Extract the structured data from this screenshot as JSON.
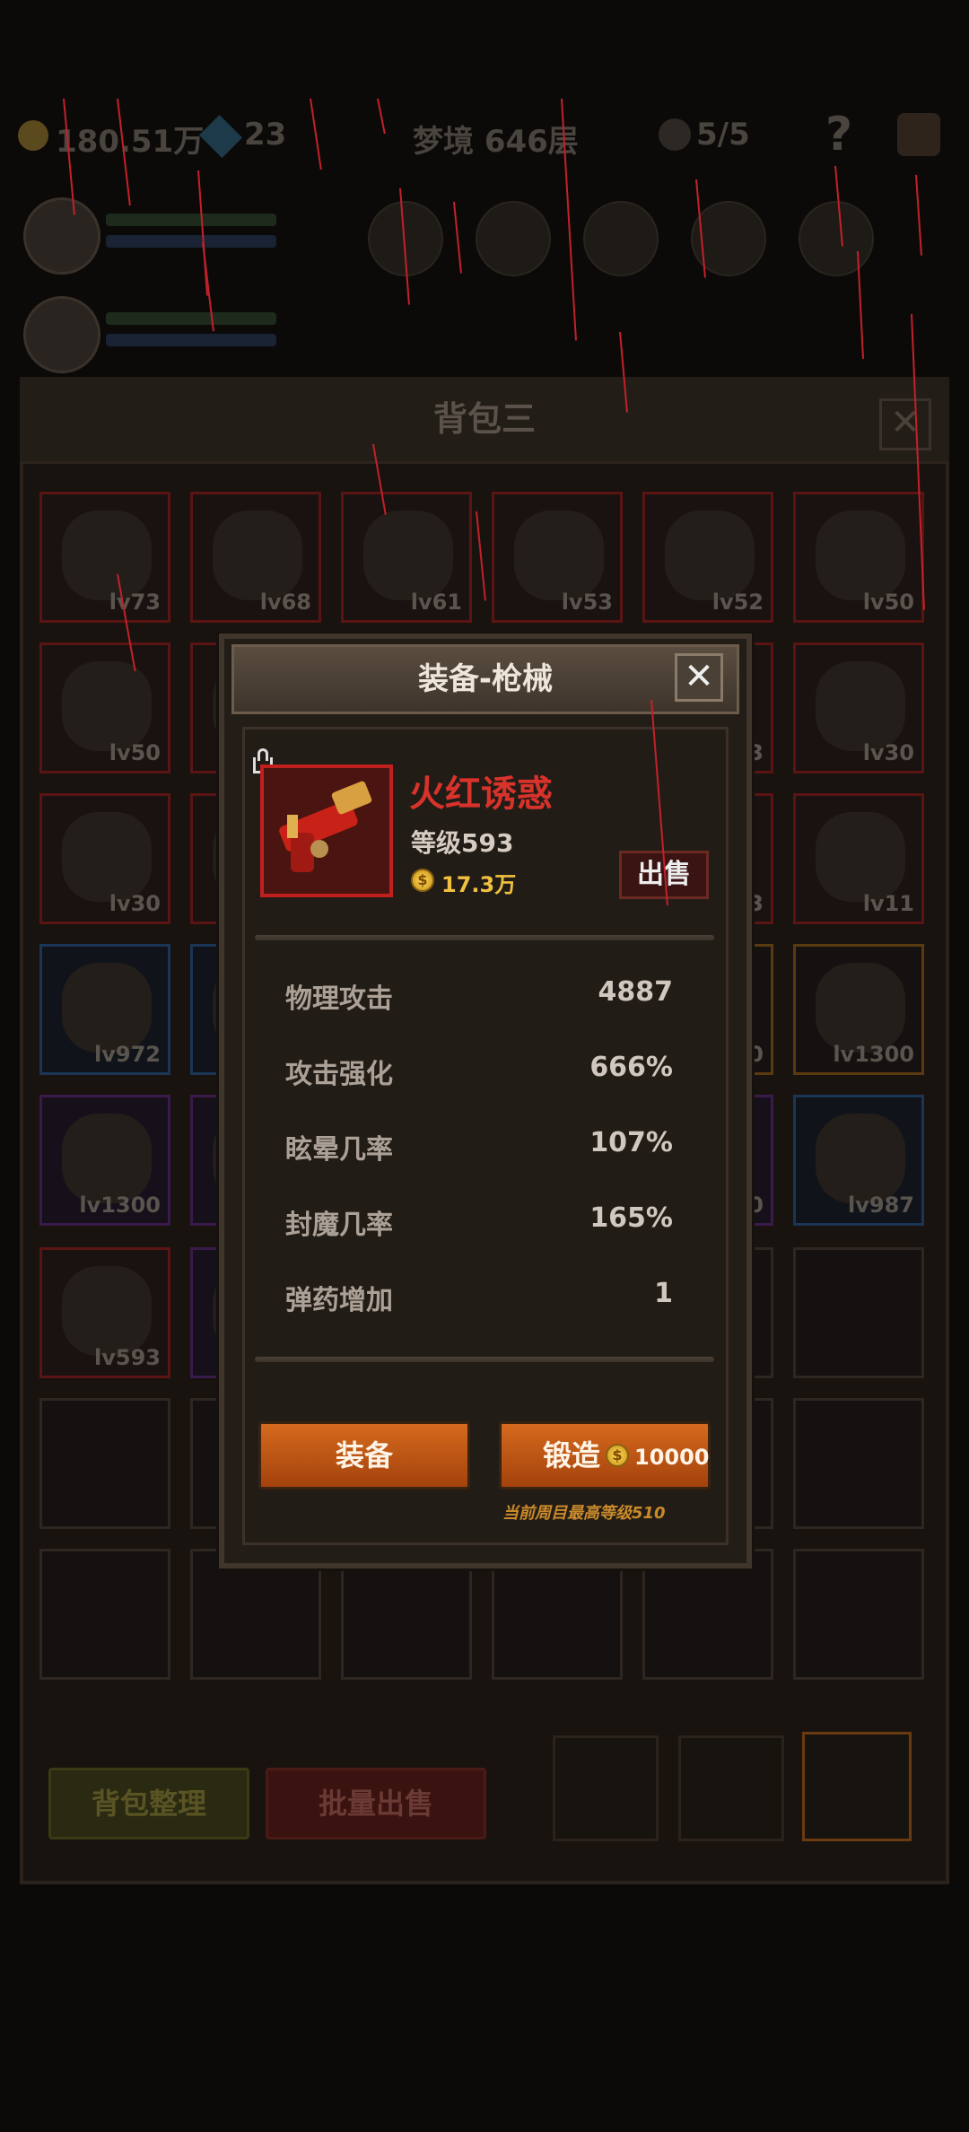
{
  "hud": {
    "gold": "180.51万",
    "gems": "23",
    "stage": "梦境 646层",
    "skulls": "5/5",
    "help": "?"
  },
  "bag": {
    "title": "背包三",
    "close": "✕",
    "slots": [
      {
        "lv": "lv73",
        "color": "red"
      },
      {
        "lv": "lv68",
        "color": "red"
      },
      {
        "lv": "lv61",
        "color": "red"
      },
      {
        "lv": "lv53",
        "color": "red"
      },
      {
        "lv": "lv52",
        "color": "red"
      },
      {
        "lv": "lv50",
        "color": "red"
      },
      {
        "lv": "lv50",
        "color": "red"
      },
      {
        "lv": "",
        "color": "red"
      },
      {
        "lv": "",
        "color": "red"
      },
      {
        "lv": "",
        "color": "red"
      },
      {
        "lv": "3",
        "color": "red"
      },
      {
        "lv": "lv30",
        "color": "red"
      },
      {
        "lv": "lv30",
        "color": "red"
      },
      {
        "lv": "",
        "color": "red"
      },
      {
        "lv": "",
        "color": "red"
      },
      {
        "lv": "",
        "color": "red"
      },
      {
        "lv": "3",
        "color": "red"
      },
      {
        "lv": "lv11",
        "color": "red"
      },
      {
        "lv": "lv972",
        "color": "blue"
      },
      {
        "lv": "",
        "color": "blue"
      },
      {
        "lv": "",
        "color": "blue"
      },
      {
        "lv": "",
        "color": "blue"
      },
      {
        "lv": "0",
        "color": "orange"
      },
      {
        "lv": "lv1300",
        "color": "orange"
      },
      {
        "lv": "lv1300",
        "color": "purple"
      },
      {
        "lv": "",
        "color": "purple"
      },
      {
        "lv": "",
        "color": "purple"
      },
      {
        "lv": "",
        "color": "purple"
      },
      {
        "lv": "00",
        "color": "purple"
      },
      {
        "lv": "lv987",
        "color": "blue"
      },
      {
        "lv": "lv593",
        "color": "red"
      },
      {
        "lv": "",
        "color": "purple"
      },
      {
        "lv": "",
        "color": "none"
      },
      {
        "lv": "",
        "color": "none"
      },
      {
        "lv": "",
        "color": "none"
      },
      {
        "lv": "",
        "color": "none"
      },
      {
        "lv": "",
        "color": "none"
      },
      {
        "lv": "",
        "color": "none"
      },
      {
        "lv": "",
        "color": "none"
      },
      {
        "lv": "",
        "color": "none"
      },
      {
        "lv": "",
        "color": "none"
      },
      {
        "lv": "",
        "color": "none"
      },
      {
        "lv": "",
        "color": "none"
      },
      {
        "lv": "",
        "color": "none"
      },
      {
        "lv": "",
        "color": "none"
      },
      {
        "lv": "",
        "color": "none"
      },
      {
        "lv": "",
        "color": "none"
      },
      {
        "lv": "",
        "color": "none"
      }
    ],
    "sort_button": "背包整理",
    "bulk_sell_button": "批量出售"
  },
  "dialog": {
    "title": "装备-枪械",
    "close": "✕",
    "item": {
      "name": "火红诱惑",
      "level": "等级593",
      "price": "17.3万",
      "coin_symbol": "$"
    },
    "sell_button": "出售",
    "stats": [
      {
        "label": "物理攻击",
        "value": "4887"
      },
      {
        "label": "攻击强化",
        "value": "666%"
      },
      {
        "label": "眩晕几率",
        "value": "107%"
      },
      {
        "label": "封魔几率",
        "value": "165%"
      },
      {
        "label": "弹药增加",
        "value": "1"
      }
    ],
    "equip_button": "装备",
    "forge_button": "锻造",
    "forge_cost": "10000",
    "note": "当前周目最高等级510"
  },
  "colors": {
    "accent_orange": "#c4561a",
    "item_name_red": "#d8332b",
    "frame_red": "#c0201e",
    "gold": "#f0c040"
  }
}
